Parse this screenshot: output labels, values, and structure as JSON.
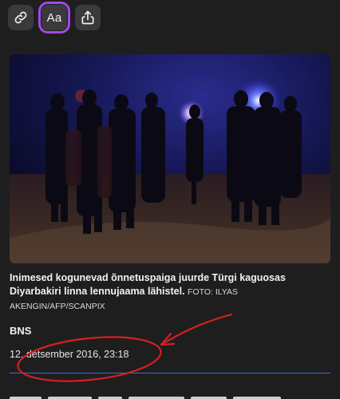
{
  "toolbar": {
    "link_icon": "link-icon",
    "text_size_label": "Aa",
    "share_icon": "share-icon",
    "active_color": "#a349e8"
  },
  "photo": {
    "alt_icon": "photo-night-crowd"
  },
  "caption": {
    "text": "Inimesed kogunevad õnnetuspaiga juurde Türgi kaguosas Diyarbakiri linna lennujaama lähistel.",
    "credit": "FOTO: ILYAS AKENGIN/AFP/SCANPIX"
  },
  "article": {
    "author": "BNS",
    "date": "12. detsember 2016, 23:18"
  },
  "annotation": {
    "color": "#d81f1f",
    "shape": "circle-with-arrow"
  },
  "colors": {
    "background": "#1e1e1f",
    "divider": "#3d6fd8"
  }
}
